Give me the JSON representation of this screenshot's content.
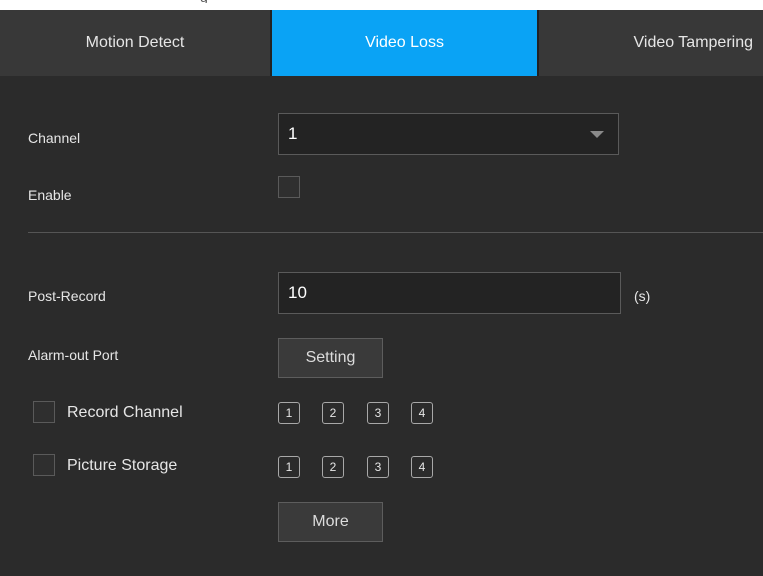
{
  "top_caption": "g",
  "tabs": [
    {
      "label": "Motion Detect",
      "active": false
    },
    {
      "label": "Video Loss",
      "active": true
    },
    {
      "label": "Video Tampering",
      "active": false
    }
  ],
  "channel": {
    "label": "Channel",
    "value": "1"
  },
  "enable": {
    "label": "Enable",
    "checked": false
  },
  "post_record": {
    "label": "Post-Record",
    "value": "10",
    "unit": "(s)"
  },
  "alarm_out_port": {
    "label": "Alarm-out Port",
    "button_label": "Setting"
  },
  "record_channel": {
    "label": "Record Channel",
    "checked": false,
    "channels": [
      "1",
      "2",
      "3",
      "4"
    ]
  },
  "picture_storage": {
    "label": "Picture Storage",
    "checked": false,
    "channels": [
      "1",
      "2",
      "3",
      "4"
    ]
  },
  "more_button_label": "More",
  "colors": {
    "panel_bg": "#2b2b2b",
    "tab_bar_bg": "#383838",
    "active_tab": "#0aa3f5",
    "text": "#e6e6e6",
    "input_bg": "#232323",
    "border": "#5a5a5a"
  }
}
